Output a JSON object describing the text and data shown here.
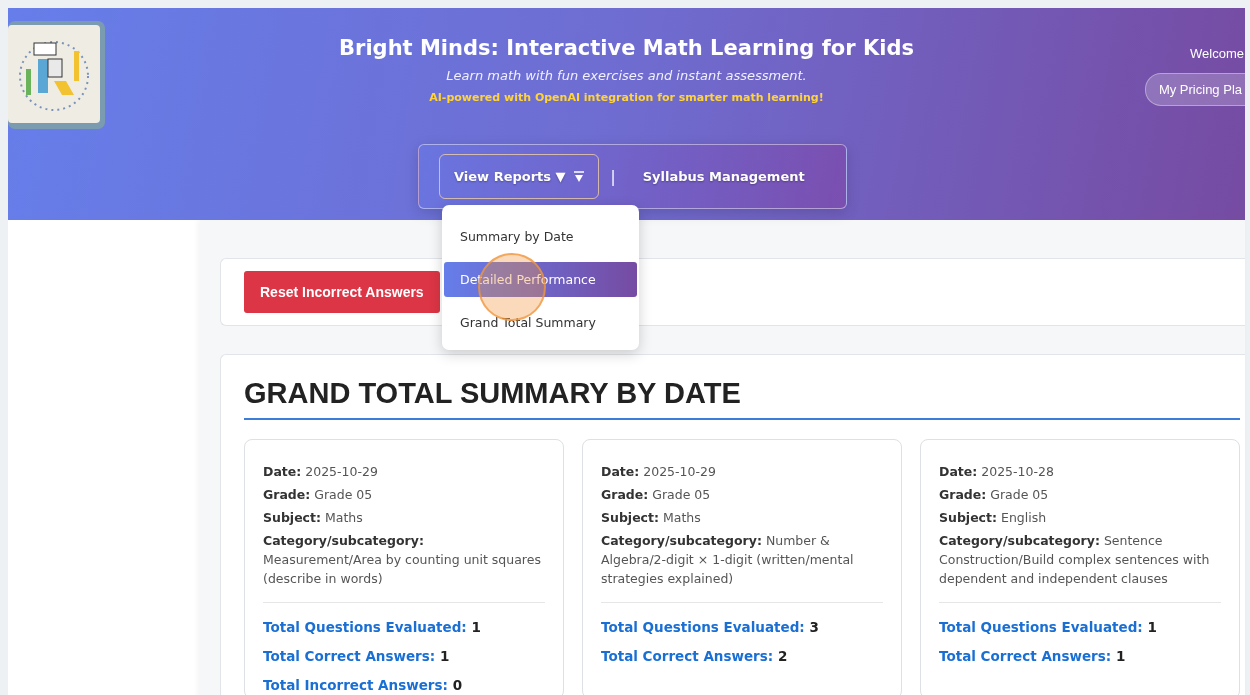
{
  "header": {
    "title": "Bright Minds: Interactive Math Learning for Kids",
    "subtitle": "Learn math with fun exercises and instant assessment.",
    "tagline": "AI-powered with OpenAI integration for smarter math learning!",
    "welcome": "Welcome",
    "pricing_button": "My Pricing Pla"
  },
  "nav": {
    "separator": "|",
    "items": [
      {
        "label": "View Reports ▼",
        "kind": "dropdown",
        "expanded": true,
        "menu": [
          {
            "label": "Summary by Date",
            "selected": false
          },
          {
            "label": "Detailed Performance",
            "selected": true
          },
          {
            "label": "Grand Total Summary",
            "selected": false
          }
        ]
      },
      {
        "label": "Syllabus Management",
        "kind": "link"
      }
    ]
  },
  "actions": {
    "reset_button": "Reset Incorrect Answers"
  },
  "summary": {
    "title": "GRAND TOTAL SUMMARY BY DATE",
    "cards": [
      {
        "fields": [
          {
            "label": "Date:",
            "value": "2025-10-29"
          },
          {
            "label": "Grade:",
            "value": "Grade 05"
          },
          {
            "label": "Subject:",
            "value": "Maths"
          },
          {
            "label": "Category/subcategory:",
            "value": "Measurement/Area by counting unit squares (describe in words)"
          }
        ],
        "totals": [
          {
            "label": "Total Questions Evaluated:",
            "value": "1"
          },
          {
            "label": "Total Correct Answers:",
            "value": "1"
          },
          {
            "label": "Total Incorrect Answers:",
            "value": "0"
          }
        ]
      },
      {
        "fields": [
          {
            "label": "Date:",
            "value": "2025-10-29"
          },
          {
            "label": "Grade:",
            "value": "Grade 05"
          },
          {
            "label": "Subject:",
            "value": "Maths"
          },
          {
            "label": "Category/subcategory:",
            "value": "Number & Algebra/2-digit × 1-digit (written/mental strategies explained)"
          }
        ],
        "totals": [
          {
            "label": "Total Questions Evaluated:",
            "value": "3"
          },
          {
            "label": "Total Correct Answers:",
            "value": "2"
          }
        ]
      },
      {
        "fields": [
          {
            "label": "Date:",
            "value": "2025-10-28"
          },
          {
            "label": "Grade:",
            "value": "Grade 05"
          },
          {
            "label": "Subject:",
            "value": "English"
          },
          {
            "label": "Category/subcategory:",
            "value": "Sentence Construction/Build complex sentences with dependent and independent clauses"
          }
        ],
        "totals": [
          {
            "label": "Total Questions Evaluated:",
            "value": "1"
          },
          {
            "label": "Total Correct Answers:",
            "value": "1"
          }
        ]
      }
    ]
  }
}
